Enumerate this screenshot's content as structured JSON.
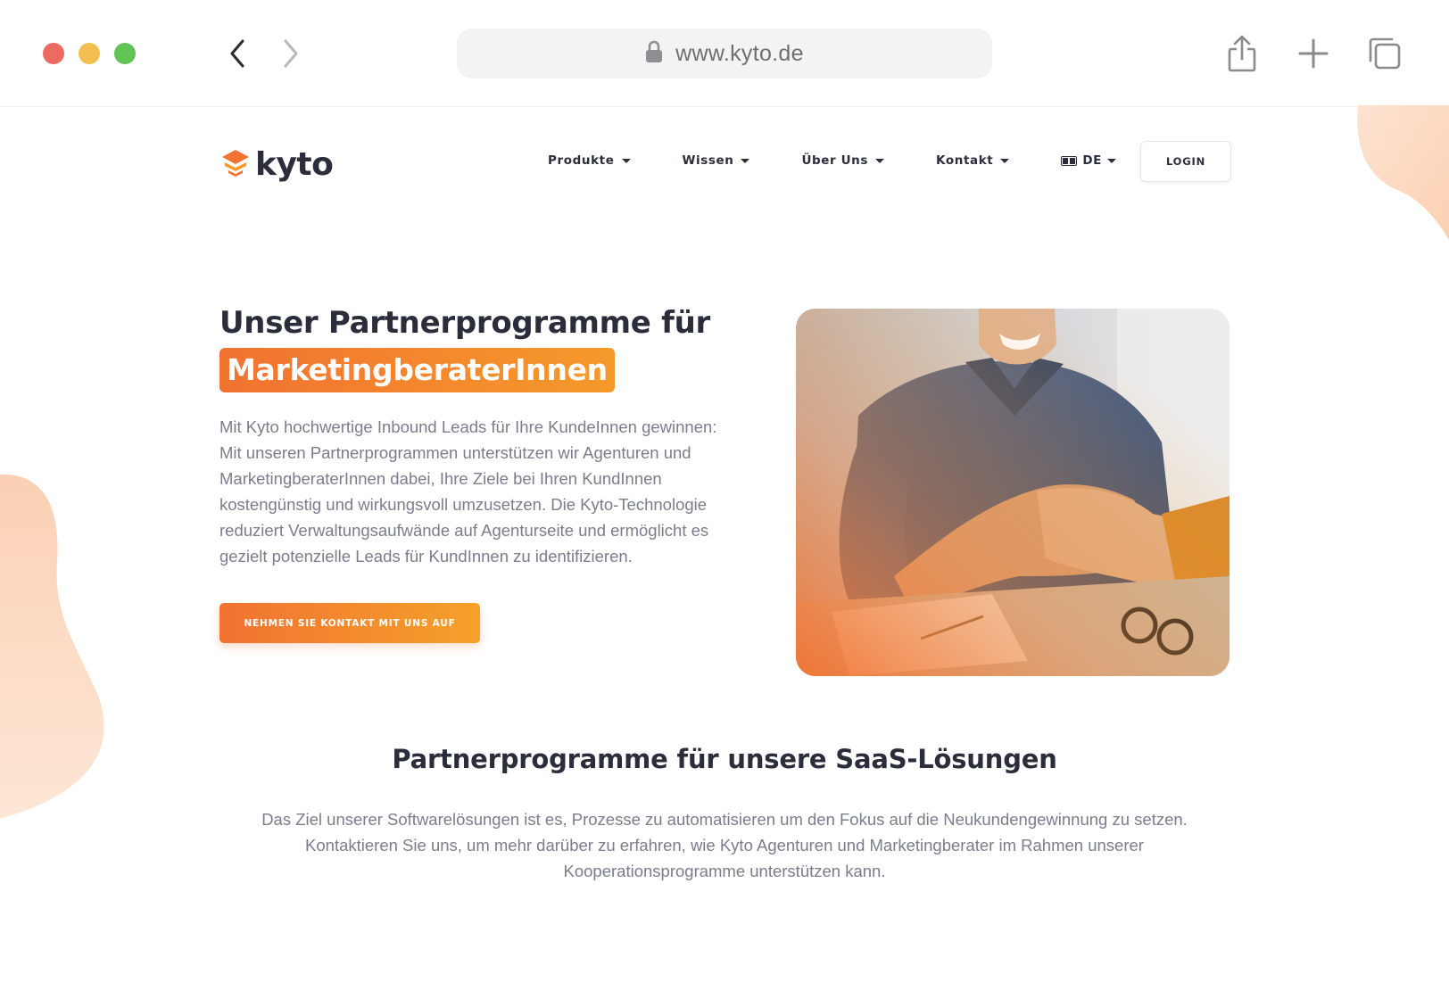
{
  "browser": {
    "url": "www.kyto.de"
  },
  "site": {
    "logo_text": "kyto",
    "menu": [
      {
        "label": "Produkte"
      },
      {
        "label": "Wissen"
      },
      {
        "label": "Über Uns"
      },
      {
        "label": "Kontakt"
      },
      {
        "label": "DE"
      }
    ],
    "login_label": "LOGIN"
  },
  "hero": {
    "title_line1": "Unser Partnerprogramme für",
    "title_highlight": "MarketingberaterInnen",
    "body": "Mit Kyto hochwertige Inbound Leads für Ihre KundeInnen gewinnen: Mit unseren Partnerprogrammen unterstützen wir Agenturen und MarketingberaterInnen dabei, Ihre Ziele bei Ihren KundInnen kostengünstig und wirkungsvoll umzusetzen. Die Kyto-Technologie reduziert Verwaltungsaufwände auf Agenturseite und ermöglicht es gezielt potenzielle Leads für KundInnen zu identifizieren.",
    "cta_label": "NEHMEN SIE KONTAKT MIT UNS AUF"
  },
  "section": {
    "title": "Partnerprogramme für unsere SaaS-Lösungen",
    "body": "Das Ziel unserer Softwarelösungen ist es, Prozesse zu automatisieren um den Fokus auf die Neukundengewinnung zu setzen. Kontaktieren Sie uns, um mehr darüber zu erfahren, wie Kyto Agenturen und Marketingberater im Rahmen unserer Kooperationsprogramme unterstützen kann."
  },
  "colors": {
    "brand_orange": "#f27231",
    "brand_orange_light": "#f5a12b",
    "heading": "#2b2e3a",
    "body_text": "#7a7e8b"
  },
  "icons": [
    "lock-icon",
    "back-arrow-icon",
    "forward-arrow-icon",
    "share-icon",
    "new-tab-icon",
    "tabs-overview-icon",
    "logo-stack-icon",
    "translate-icon"
  ]
}
